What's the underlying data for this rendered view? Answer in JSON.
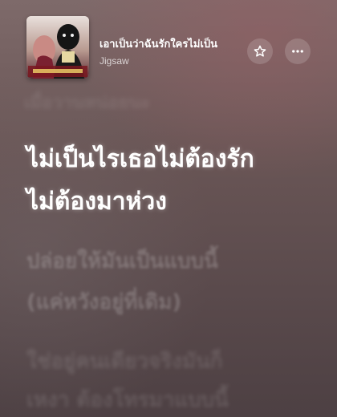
{
  "now_playing": {
    "title": "เอาเป็นว่าฉันรักใครไม่เป็น",
    "artist": "Jigsaw",
    "artwork_icon": "album-artwork",
    "favorite_icon": "star-icon",
    "more_icon": "more-icon"
  },
  "lyrics": {
    "previous": "เมื่อวานหน่อยนะ",
    "current": [
      "ไม่เป็นไรเธอไม่ต้องรัก",
      "ไม่ต้องมาห่วง"
    ],
    "upcoming": [
      "ปล่อยให้มันเป็นแบบนี้",
      "(แค่หวังอยู่ที่เดิม)",
      "ใช่อยู่คนเดียวจริงมันก็",
      "เหงา ต้องโทรมาแบบนี้"
    ]
  },
  "colors": {
    "active_lyric": "#ffffff",
    "background": "#6a5656"
  }
}
